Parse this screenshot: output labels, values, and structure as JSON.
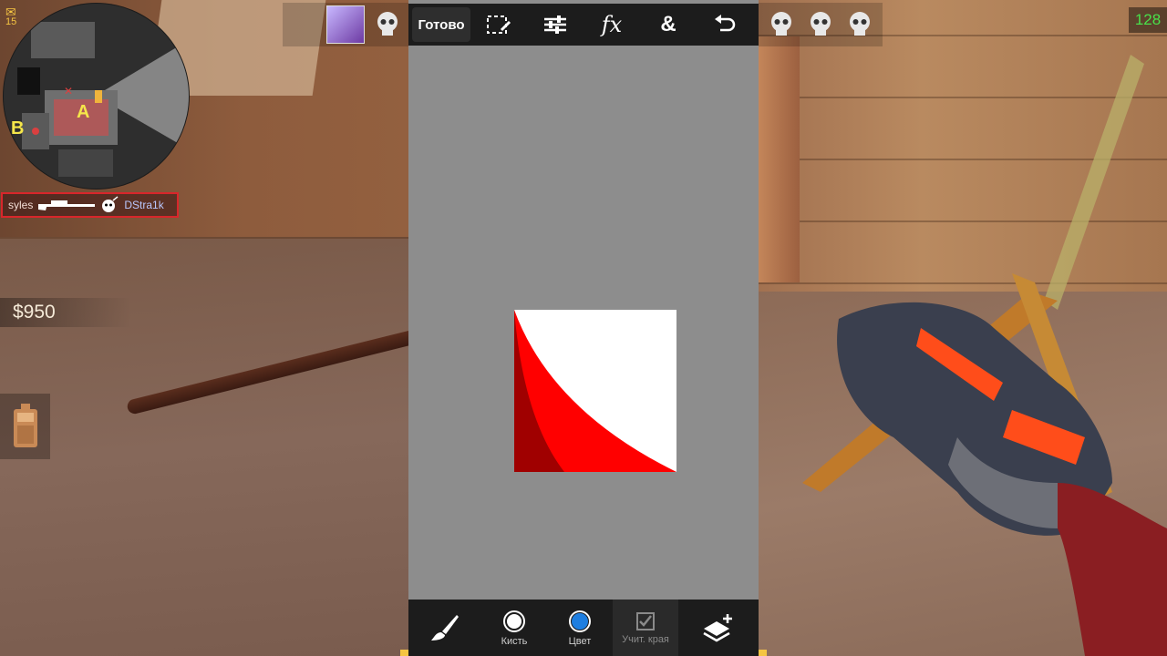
{
  "hud": {
    "mail_count": "15",
    "fps": "128",
    "money": "$950",
    "killfeed": {
      "killer": "syles",
      "victim": "DStra1k",
      "weapon_icon": "sniper-rifle-icon"
    },
    "minimap_labels": {
      "a": "A",
      "b": "B"
    }
  },
  "editor": {
    "toolbar": {
      "done_label": "Готово",
      "tools": [
        "selection-icon",
        "adjust-sliders-icon",
        "fx-icon",
        "blend-icon",
        "undo-icon"
      ],
      "fx_label": "fx",
      "amp_label": "&"
    },
    "bottombar": {
      "brush_size_label": "Кисть",
      "color_label": "Цвет",
      "edge_label": "Учит. края"
    },
    "colors": {
      "canvas_bg": "#8d8d8d",
      "bar_bg": "#1c1c1c",
      "selected_color": "#1e7ee0",
      "shape_red": "#ff0000",
      "shape_dark_red": "#a00000",
      "shape_white": "#ffffff"
    }
  }
}
